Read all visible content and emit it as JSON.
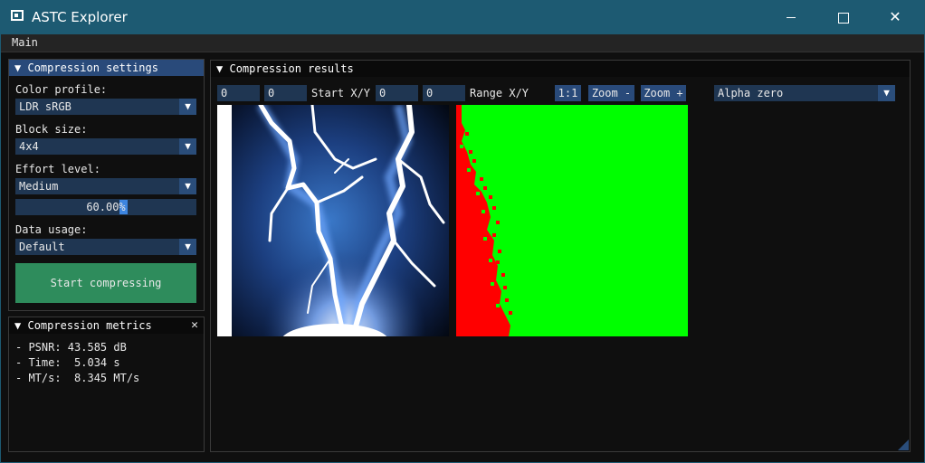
{
  "window": {
    "title": "ASTC Explorer"
  },
  "menu": {
    "main": "Main"
  },
  "settings": {
    "header": "Compression settings",
    "color_profile_label": "Color profile:",
    "color_profile_value": "LDR sRGB",
    "block_size_label": "Block size:",
    "block_size_value": "4x4",
    "effort_label": "Effort level:",
    "effort_value": "Medium",
    "effort_slider_text": "60.00%",
    "effort_percent": 60,
    "data_usage_label": "Data usage:",
    "data_usage_value": "Default",
    "start_button": "Start compressing"
  },
  "metrics": {
    "header": "Compression metrics",
    "close": "✕",
    "psnr": "- PSNR: 43.585 dB",
    "time": "- Time:  5.034 s",
    "mts": "- MT/s:  8.345 MT/s"
  },
  "results": {
    "header": "Compression results",
    "start_x": "0",
    "start_y": "0",
    "start_label": "Start X/Y",
    "range_x": "0",
    "range_y": "0",
    "range_label": "Range X/Y",
    "zoom_reset": "1:1",
    "zoom_out": "Zoom -",
    "zoom_in": "Zoom +",
    "view_mode": "Alpha zero"
  },
  "colors": {
    "accent": "#294a7a",
    "frame_bg": "#1f3652",
    "button_green": "#2e8c5c",
    "title_bar": "#1d5a72",
    "diff_green": "#00ff00",
    "diff_red": "#ff0000"
  }
}
